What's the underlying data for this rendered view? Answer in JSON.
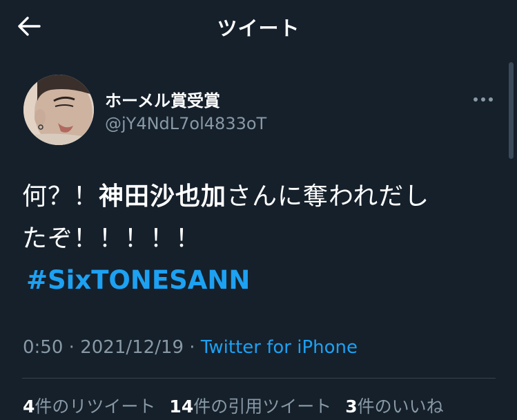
{
  "header": {
    "title": "ツイート",
    "back_icon": "arrow-left-icon"
  },
  "tweet": {
    "author": {
      "name": "ホーメル賞受賞",
      "handle": "@jY4NdL7ol4833oT"
    },
    "text_part1": "何？！",
    "text_bold": "神田沙也加",
    "text_part2": "さんに奪われだし",
    "text_line2": "たぞ！！！！！",
    "hashtag": "#SixTONESANN",
    "time": "0:50",
    "separator1": " · ",
    "date": "2021/12/19",
    "separator2": " · ",
    "source": "Twitter for iPhone"
  },
  "stats": {
    "retweets_count": "4",
    "retweets_label": "件のリツイート",
    "quotes_count": "14",
    "quotes_label": "件の引用ツイート",
    "likes_count": "3",
    "likes_label": "件のいいね"
  },
  "colors": {
    "background": "#15202b",
    "accent": "#1da1f2",
    "secondary_text": "#8899a6",
    "divider": "#38444d"
  }
}
